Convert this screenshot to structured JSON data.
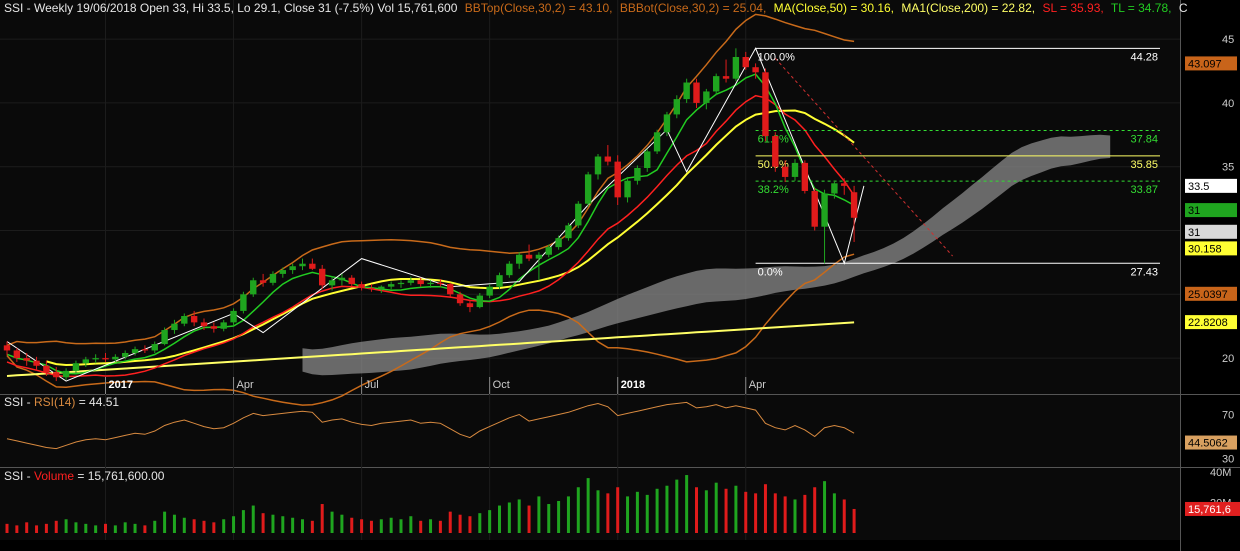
{
  "colors": {
    "up": "#1fa51f",
    "down": "#e01b1b",
    "ma50": "#ffff33",
    "ma200": "#ffff66",
    "bb": "#c86a1a",
    "sl": "#ff2020",
    "tl": "#22cc22",
    "fib": "#33dd33",
    "cloud": "#8a8a8a",
    "rsi": "#d88a40",
    "bg": "#000000",
    "panel": "#1a1a1a"
  },
  "header": {
    "symbol_line": "SSI - Weekly 19/06/2018 Open 33, Hi 33.5, Lo 29.1, Close 31 (-7.5%) Vol 15,761,600",
    "bbtop": "BBTop(Close,30,2) = 43.10,",
    "bbbot": "BBBot(Close,30,2) = 25.04,",
    "ma": "MA(Close,50) = 30.16,",
    "ma1": "MA1(Close,200) = 22.82,",
    "sl": "SL = 35.93,",
    "tl": "TL = 34.78,",
    "tail": "C"
  },
  "rsi_header": {
    "prefix": "SSI - ",
    "name": "RSI(14)",
    "value": " = 44.51"
  },
  "vol_header": {
    "prefix": "SSI - ",
    "name": "Volume",
    "value": " = 15,761,600.00"
  },
  "x_labels": [
    "2017",
    "Apr",
    "Jul",
    "Oct",
    "2018",
    "Apr"
  ],
  "price_axis": [
    "45",
    "40",
    "35",
    "30",
    "25",
    "20"
  ],
  "price_tags": [
    {
      "text": "43.097",
      "bg": "#c8641a",
      "fg": "#000000"
    },
    {
      "text": "33.5",
      "bg": "#ffffff",
      "fg": "#000000"
    },
    {
      "text": "31",
      "bg": "#1fa51f",
      "fg": "#000000"
    },
    {
      "text": "31",
      "bg": "#d8d8d8",
      "fg": "#000000"
    },
    {
      "text": "30.158",
      "bg": "#ffff33",
      "fg": "#000000"
    },
    {
      "text": "25.0397",
      "bg": "#c8641a",
      "fg": "#000000"
    },
    {
      "text": "22.8208",
      "bg": "#ffff33",
      "fg": "#000000"
    }
  ],
  "rsi_axis": [
    "70",
    "30"
  ],
  "rsi_tag": "44.5062",
  "vol_axis": [
    "40M",
    "20M"
  ],
  "vol_tag": "15,761,6",
  "fib_levels": [
    {
      "pct": "100.0%",
      "value": "44.28"
    },
    {
      "pct": "61.8%",
      "value": "37.84"
    },
    {
      "pct": "50.0%",
      "value": "35.85"
    },
    {
      "pct": "38.2%",
      "value": "33.87"
    },
    {
      "pct": "0.0%",
      "value": "27.43"
    }
  ],
  "chart_data": [
    {
      "type": "candlestick",
      "title": "SSI - Weekly",
      "x_ticks": [
        "2017",
        "Apr",
        "Jul",
        "Oct",
        "2018",
        "Apr"
      ],
      "ylim": [
        17.5,
        46.5
      ],
      "y_ticks": [
        20,
        25,
        30,
        35,
        40,
        45
      ],
      "ohlc": [
        [
          21.0,
          21.3,
          20.2,
          20.6
        ],
        [
          20.6,
          20.8,
          19.7,
          20.0
        ],
        [
          20.0,
          20.4,
          19.4,
          19.8
        ],
        [
          19.8,
          20.1,
          19.0,
          19.4
        ],
        [
          19.4,
          19.8,
          18.6,
          18.9
        ],
        [
          18.9,
          19.3,
          18.2,
          18.5
        ],
        [
          18.5,
          19.2,
          18.3,
          19.0
        ],
        [
          19.0,
          19.8,
          18.8,
          19.6
        ],
        [
          19.6,
          20.1,
          19.3,
          19.9
        ],
        [
          19.9,
          20.3,
          19.6,
          20.0
        ],
        [
          20.0,
          20.4,
          19.7,
          19.9
        ],
        [
          19.9,
          20.3,
          19.7,
          20.1
        ],
        [
          20.1,
          20.6,
          19.9,
          20.4
        ],
        [
          20.4,
          20.9,
          20.2,
          20.7
        ],
        [
          20.7,
          21.0,
          20.4,
          20.6
        ],
        [
          20.6,
          21.3,
          20.4,
          21.1
        ],
        [
          21.1,
          22.4,
          21.0,
          22.2
        ],
        [
          22.2,
          23.0,
          21.9,
          22.7
        ],
        [
          22.7,
          23.5,
          22.5,
          23.3
        ],
        [
          23.3,
          23.7,
          22.5,
          22.8
        ],
        [
          22.8,
          23.1,
          22.2,
          22.5
        ],
        [
          22.5,
          22.8,
          22.0,
          22.3
        ],
        [
          22.3,
          23.0,
          22.1,
          22.8
        ],
        [
          22.8,
          23.9,
          22.6,
          23.7
        ],
        [
          23.7,
          25.2,
          23.5,
          25.0
        ],
        [
          25.0,
          26.3,
          24.8,
          26.1
        ],
        [
          26.1,
          26.6,
          25.6,
          25.9
        ],
        [
          25.9,
          26.8,
          25.7,
          26.6
        ],
        [
          26.6,
          27.1,
          26.3,
          26.9
        ],
        [
          26.9,
          27.4,
          26.6,
          27.2
        ],
        [
          27.2,
          27.8,
          26.9,
          27.4
        ],
        [
          27.4,
          27.8,
          26.9,
          27.0
        ],
        [
          27.0,
          27.3,
          25.4,
          25.7
        ],
        [
          25.7,
          26.4,
          25.3,
          26.1
        ],
        [
          26.1,
          26.6,
          25.7,
          26.3
        ],
        [
          26.3,
          26.5,
          25.6,
          25.8
        ],
        [
          25.8,
          26.0,
          25.3,
          25.5
        ],
        [
          25.5,
          25.8,
          25.2,
          25.4
        ],
        [
          25.4,
          25.7,
          25.1,
          25.6
        ],
        [
          25.6,
          26.0,
          25.4,
          25.8
        ],
        [
          25.8,
          26.1,
          25.5,
          25.9
        ],
        [
          25.9,
          26.4,
          25.7,
          26.1
        ],
        [
          26.1,
          26.3,
          25.6,
          25.8
        ],
        [
          25.8,
          26.1,
          25.5,
          25.9
        ],
        [
          25.9,
          26.2,
          25.6,
          25.8
        ],
        [
          25.8,
          25.9,
          24.8,
          25.0
        ],
        [
          25.0,
          25.2,
          24.1,
          24.3
        ],
        [
          24.3,
          24.6,
          23.6,
          24.0
        ],
        [
          24.0,
          25.1,
          23.9,
          24.9
        ],
        [
          24.9,
          25.8,
          24.7,
          25.6
        ],
        [
          25.6,
          26.7,
          25.4,
          26.5
        ],
        [
          26.5,
          27.6,
          26.3,
          27.4
        ],
        [
          27.4,
          28.3,
          27.0,
          28.1
        ],
        [
          28.1,
          28.9,
          27.6,
          27.8
        ],
        [
          27.8,
          28.3,
          26.1,
          28.1
        ],
        [
          28.1,
          28.9,
          27.9,
          28.7
        ],
        [
          28.7,
          29.6,
          28.5,
          29.4
        ],
        [
          29.4,
          30.6,
          29.2,
          30.4
        ],
        [
          30.4,
          32.3,
          30.2,
          32.1
        ],
        [
          32.1,
          34.6,
          31.9,
          34.4
        ],
        [
          34.4,
          36.0,
          34.0,
          35.8
        ],
        [
          35.8,
          36.7,
          35.1,
          35.4
        ],
        [
          35.4,
          35.9,
          32.0,
          32.6
        ],
        [
          32.6,
          34.2,
          32.2,
          33.9
        ],
        [
          33.9,
          35.1,
          33.6,
          34.9
        ],
        [
          34.9,
          36.4,
          34.6,
          36.2
        ],
        [
          36.2,
          37.9,
          36.0,
          37.7
        ],
        [
          37.7,
          39.3,
          37.4,
          39.1
        ],
        [
          39.1,
          40.6,
          38.8,
          40.3
        ],
        [
          40.3,
          41.9,
          40.0,
          41.6
        ],
        [
          41.6,
          41.9,
          39.6,
          40.0
        ],
        [
          40.0,
          41.1,
          39.5,
          40.9
        ],
        [
          40.9,
          42.3,
          40.6,
          42.1
        ],
        [
          42.1,
          43.4,
          41.6,
          41.9
        ],
        [
          41.9,
          44.28,
          41.7,
          43.6
        ],
        [
          43.6,
          44.0,
          42.6,
          42.8
        ],
        [
          42.8,
          43.1,
          41.9,
          42.4
        ],
        [
          42.4,
          42.7,
          37.0,
          37.4
        ],
        [
          37.4,
          37.7,
          34.6,
          35.0
        ],
        [
          35.0,
          35.5,
          33.8,
          34.2
        ],
        [
          34.2,
          35.6,
          33.9,
          35.3
        ],
        [
          35.3,
          35.5,
          32.9,
          33.1
        ],
        [
          33.1,
          33.3,
          30.0,
          30.3
        ],
        [
          30.3,
          33.2,
          27.43,
          32.9
        ],
        [
          32.9,
          33.8,
          32.5,
          33.7
        ],
        [
          33.7,
          34.1,
          32.8,
          33.5
        ],
        [
          33.0,
          33.5,
          29.1,
          31.0
        ]
      ],
      "series": [
        {
          "name": "MA(Close,50)",
          "last": 30.16
        },
        {
          "name": "MA1(Close,200)",
          "last": 22.82
        },
        {
          "name": "BBTop(Close,30,2)",
          "last": 43.1
        },
        {
          "name": "BBBot(Close,30,2)",
          "last": 25.04
        },
        {
          "name": "SL",
          "last": 35.93
        },
        {
          "name": "TL",
          "last": 34.78
        }
      ],
      "fibonacci": [
        {
          "pct": 100.0,
          "value": 44.28
        },
        {
          "pct": 61.8,
          "value": 37.84
        },
        {
          "pct": 50.0,
          "value": 35.85
        },
        {
          "pct": 38.2,
          "value": 33.87
        },
        {
          "pct": 0.0,
          "value": 27.43
        }
      ]
    },
    {
      "type": "line",
      "title": "SSI - RSI(14)",
      "last": 44.51,
      "y_ticks": [
        70,
        30
      ],
      "values": [
        48,
        46,
        44,
        42,
        40,
        39,
        42,
        45,
        47,
        48,
        47,
        49,
        51,
        53,
        52,
        55,
        60,
        63,
        65,
        62,
        59,
        57,
        58,
        62,
        67,
        71,
        69,
        70,
        71,
        72,
        73,
        72,
        63,
        65,
        66,
        63,
        61,
        60,
        62,
        63,
        64,
        65,
        62,
        63,
        62,
        57,
        52,
        49,
        55,
        59,
        63,
        67,
        70,
        64,
        66,
        68,
        70,
        72,
        75,
        78,
        80,
        77,
        69,
        71,
        73,
        75,
        77,
        79,
        80,
        81,
        76,
        77,
        79,
        76,
        78,
        76,
        74,
        62,
        58,
        56,
        60,
        56,
        50,
        58,
        60,
        58,
        53
      ]
    },
    {
      "type": "bar",
      "title": "SSI - Volume",
      "last": 15761600,
      "y_ticks": [
        "40M",
        "20M"
      ],
      "values": [
        6,
        5,
        7,
        5,
        6,
        8,
        9,
        7,
        6,
        5,
        6,
        5,
        7,
        6,
        5,
        8,
        14,
        12,
        10,
        9,
        8,
        7,
        9,
        11,
        15,
        18,
        13,
        12,
        11,
        10,
        9,
        8,
        19,
        14,
        12,
        10,
        9,
        8,
        9,
        10,
        9,
        11,
        8,
        9,
        8,
        14,
        12,
        11,
        13,
        15,
        18,
        20,
        22,
        18,
        24,
        19,
        21,
        24,
        30,
        36,
        28,
        26,
        30,
        24,
        27,
        25,
        29,
        31,
        35,
        38,
        30,
        28,
        33,
        29,
        31,
        27,
        26,
        32,
        26,
        24,
        22,
        25,
        30,
        34,
        26,
        22,
        15.76
      ],
      "up": [
        0,
        0,
        0,
        0,
        0,
        0,
        1,
        1,
        1,
        1,
        0,
        1,
        1,
        1,
        0,
        1,
        1,
        1,
        1,
        0,
        0,
        0,
        1,
        1,
        1,
        1,
        0,
        1,
        1,
        1,
        1,
        0,
        0,
        1,
        1,
        0,
        0,
        0,
        1,
        1,
        1,
        1,
        0,
        1,
        0,
        0,
        0,
        0,
        1,
        1,
        1,
        1,
        1,
        0,
        1,
        1,
        1,
        1,
        1,
        1,
        1,
        0,
        0,
        1,
        1,
        1,
        1,
        1,
        1,
        1,
        0,
        1,
        1,
        0,
        1,
        0,
        0,
        0,
        0,
        0,
        1,
        0,
        0,
        1,
        1,
        0,
        0
      ]
    }
  ]
}
